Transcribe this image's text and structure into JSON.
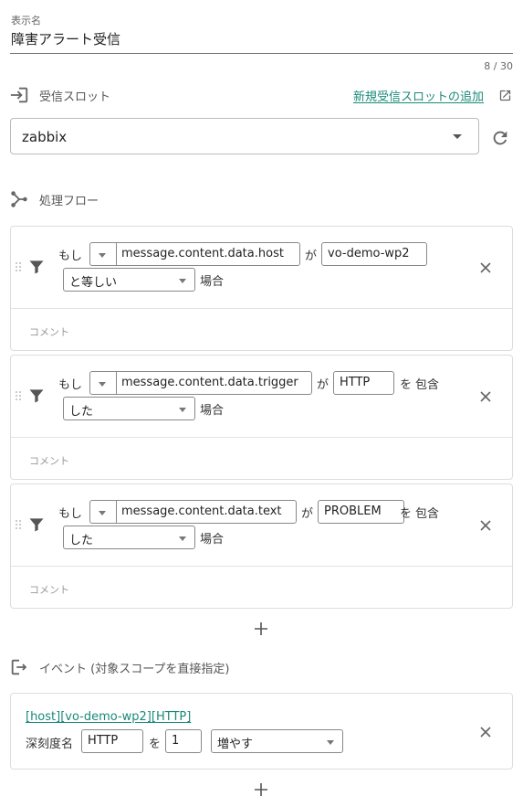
{
  "display_name": {
    "label": "表示名",
    "value": "障害アラート受信",
    "counter": "8 / 30"
  },
  "slot": {
    "title": "受信スロット",
    "new_link": "新規受信スロットの追加",
    "selected": "zabbix"
  },
  "flow": {
    "title": "処理フロー",
    "comment_placeholder": "コメント",
    "conditions": [
      {
        "prefix": "もし",
        "field": "message.content.data.host",
        "ga": "が",
        "value": "vo-demo-wp2",
        "wo": "",
        "op1": "",
        "op2": "と等しい",
        "suffix": "場合"
      },
      {
        "prefix": "もし",
        "field": "message.content.data.trigger",
        "ga": "が",
        "value": "HTTP",
        "wo": "を",
        "op1": "包含",
        "op2": "した",
        "suffix": "場合"
      },
      {
        "prefix": "もし",
        "field": "message.content.data.text",
        "ga": "が",
        "value": "PROBLEM",
        "wo": "を",
        "op1": "包含",
        "op2": "した",
        "suffix": "場合"
      }
    ]
  },
  "event": {
    "title": "イベント (対象スコープを直接指定)",
    "scope_link": "[host][vo-demo-wp2][HTTP]",
    "severity_label": "深刻度名",
    "severity_value": "HTTP",
    "wo": "を",
    "amount": "1",
    "action": "増やす"
  },
  "colors": {
    "accent": "#1a8a7a",
    "border": "#dddddd"
  }
}
